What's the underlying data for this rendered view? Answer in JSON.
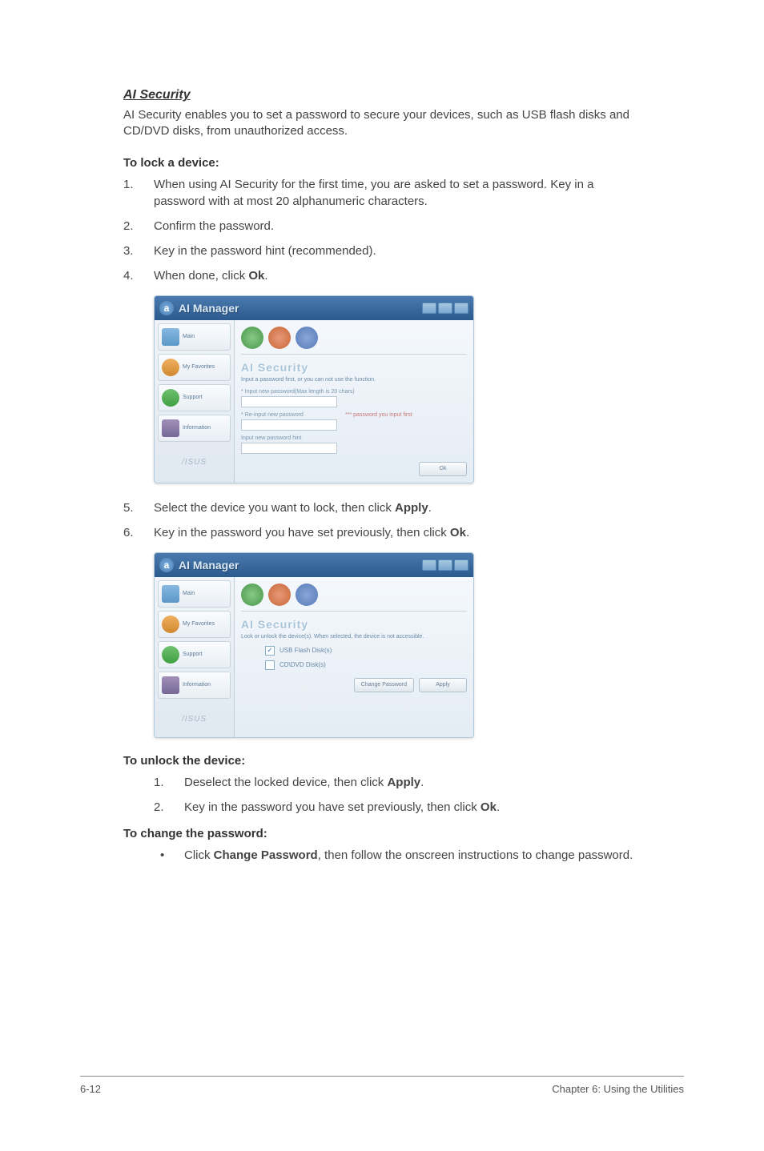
{
  "section": {
    "title": "AI Security",
    "intro": "AI Security enables you to set a password to secure your devices, such as USB flash disks and CD/DVD disks, from unauthorized access."
  },
  "lock": {
    "heading": "To lock a device:",
    "steps": {
      "s1": "When using AI Security for the first time, you are asked to set a password. Key in a password with at most 20 alphanumeric characters.",
      "s2": "Confirm the password.",
      "s3": "Key in the password hint (recommended).",
      "s4_a": "When done, click ",
      "s4_b": "Ok",
      "s4_c": ".",
      "s5_a": "Select the device you want to lock, then click ",
      "s5_b": "Apply",
      "s5_c": ".",
      "s6_a": "Key in the password you have set previously, then click ",
      "s6_b": "Ok",
      "s6_c": "."
    }
  },
  "unlock": {
    "heading": "To unlock the device:",
    "steps": {
      "s1_a": "Deselect the locked device, then click ",
      "s1_b": "Apply",
      "s1_c": ".",
      "s2_a": "Key in the password you have set previously, then click ",
      "s2_b": "Ok",
      "s2_c": "."
    }
  },
  "change": {
    "heading": "To change the password:",
    "bullet_a": "Click ",
    "bullet_b": "Change Password",
    "bullet_c": ", then follow the onscreen instructions to change password."
  },
  "screenshot1": {
    "app_title": "AI Manager",
    "sidebar": {
      "main": "Main",
      "favorites": "My Favorites",
      "support": "Support",
      "info": "Information"
    },
    "brand": "/ISUS",
    "panel_title": "AI Security",
    "desc": "Input a password first, or you can not use the function.",
    "field1": "* Input new password(Max length is 20 chars)",
    "field2": "* Re-input new password",
    "note": "*** password you input first",
    "field3": "Input new password hint",
    "ok_btn": "Ok"
  },
  "screenshot2": {
    "app_title": "AI Manager",
    "sidebar": {
      "main": "Main",
      "favorites": "My Favorites",
      "support": "Support",
      "info": "Information"
    },
    "brand": "/ISUS",
    "panel_title": "AI Security",
    "desc": "Lock or unlock the device(s). When selected, the device is not accessible.",
    "opt1": "USB Flash Disk(s)",
    "opt2": "CD\\DVD Disk(s)",
    "change_btn": "Change Password",
    "apply_btn": "Apply"
  },
  "footer": {
    "left": "6-12",
    "right": "Chapter 6: Using the Utilities"
  }
}
